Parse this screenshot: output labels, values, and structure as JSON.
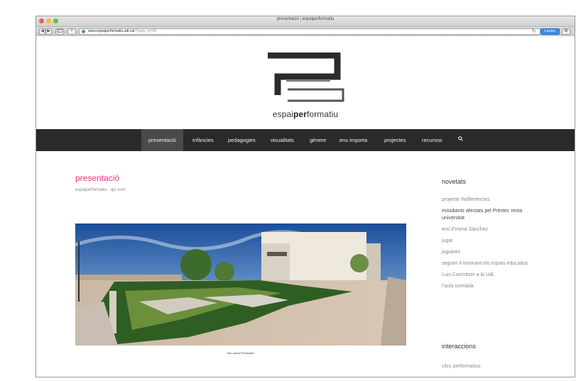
{
  "browser": {
    "window_title": "presentació | espaiperformatiu",
    "url_host": "www.espaiperformatiu.udl.cat",
    "url_path": "/?page_id=48",
    "reader_label": "Lector",
    "back_label": "◀",
    "forward_label": "▶",
    "add_label": "+"
  },
  "site": {
    "logo_prefix": "espai",
    "logo_bold": "per",
    "logo_suffix": "formatiu"
  },
  "nav": {
    "items": [
      "presentació",
      "infàncies",
      "pedagogies",
      "visualitats",
      "gènere",
      "ens importa",
      "projectes",
      "recursos"
    ],
    "active": "presentació"
  },
  "main": {
    "title": "presentació",
    "breadcrumbs": [
      "espaiperformatiu",
      "qui som"
    ],
    "photo_caption": "foto Laura Fernández"
  },
  "sidebar": {
    "news_heading": "novetats",
    "news_items": [
      "projecte INdiferències",
      "estudiants afectats pel Préstec renta universitat",
      "tesi d’Imma Sànchez",
      "jugar",
      "joguines",
      "seguim il·luminant els espais educatius",
      "Luis Camnitzer a la UdL",
      "l’aula somiada"
    ],
    "interactions_heading": "interaccions",
    "interactions_first": "clics performatius"
  },
  "colors": {
    "accent": "#e8327b",
    "nav_bg": "#2a2a2a"
  }
}
